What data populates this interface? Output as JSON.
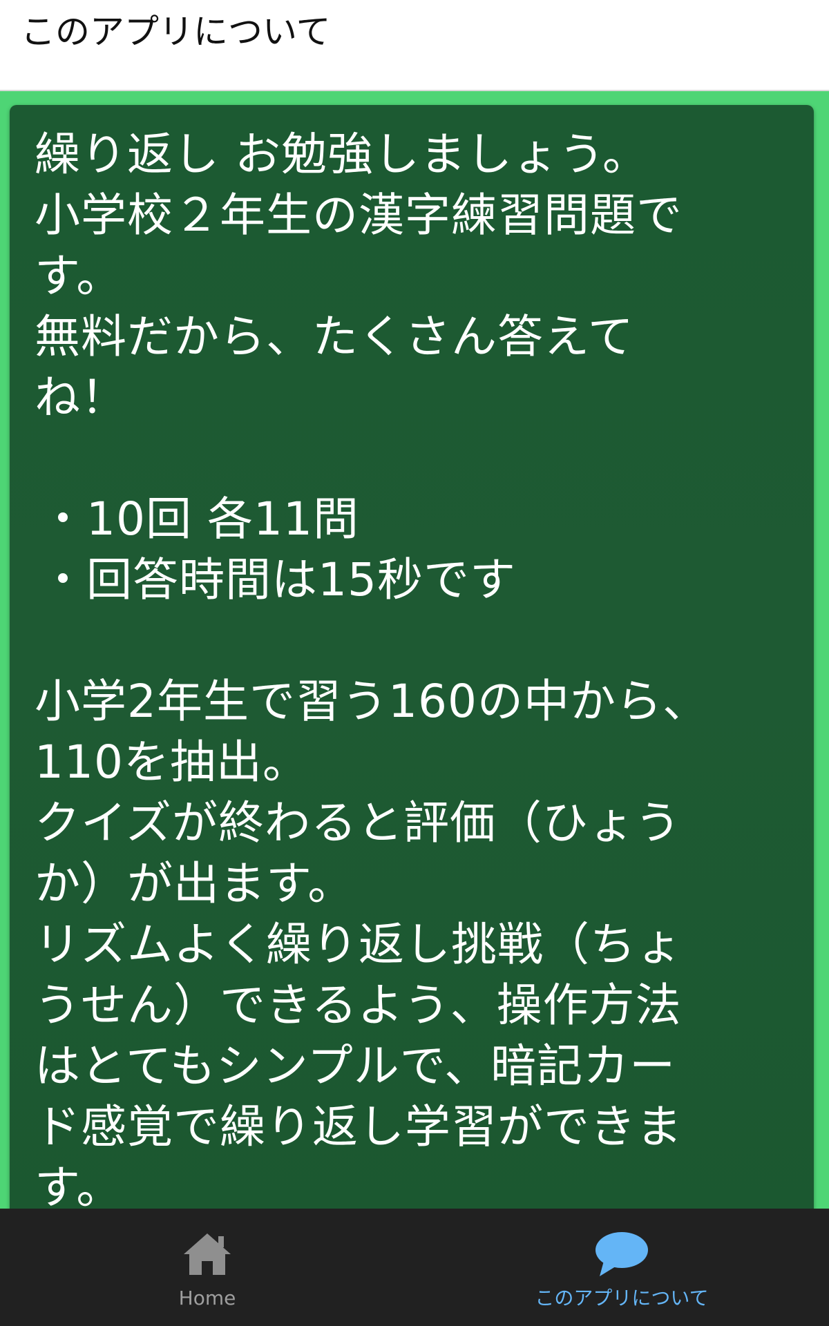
{
  "appbar": {
    "title": "このアプリについて"
  },
  "content": {
    "lines": [
      "繰り返し お勉強しましょう。",
      "小学校２年生の漢字練習問題で",
      "す。",
      "無料だから、たくさん答えて",
      "ね！",
      "",
      "・10回 各11問",
      "・回答時間は15秒です",
      "",
      "小学2年生で習う160の中から、",
      "110を抽出。",
      "クイズが終わると評価（ひょう",
      "か）が出ます。",
      "リズムよく繰り返し挑戦（ちょ",
      "うせん）できるよう、操作方法",
      "はとてもシンプルで、暗記カー",
      "ド感覚で繰り返し学習ができま",
      "す。"
    ]
  },
  "bottom_nav": {
    "items": [
      {
        "label": "Home",
        "icon": "home-icon",
        "active": false
      },
      {
        "label": "このアプリについて",
        "icon": "chat-bubble-icon",
        "active": true
      }
    ]
  },
  "colors": {
    "background_green": "#4ed575",
    "board_green": "#1c5a32",
    "nav_background": "#212121",
    "nav_active": "#64b5f6",
    "nav_inactive": "#9e9e9e"
  }
}
